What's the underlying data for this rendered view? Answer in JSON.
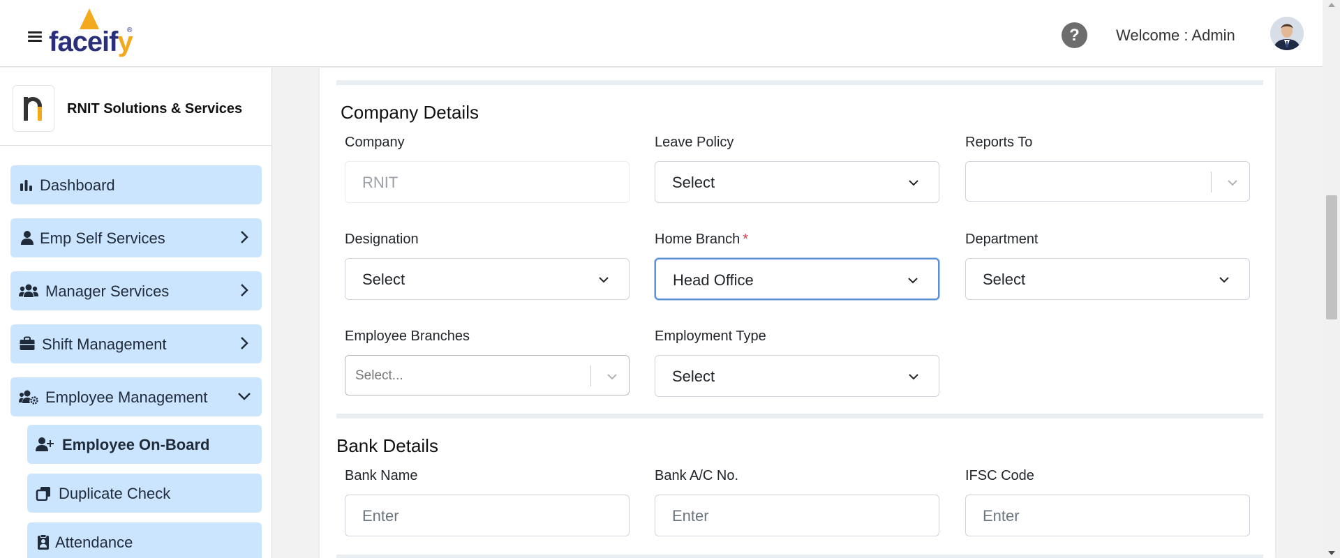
{
  "header": {
    "logo_text": "faceif",
    "logo_text_y": "y",
    "logo_reg": "®",
    "help_symbol": "?",
    "welcome": "Welcome : Admin"
  },
  "sidebar": {
    "org_name": "RNIT Solutions & Services",
    "items": [
      {
        "label": "Dashboard",
        "icon": "bar-chart-icon",
        "chevron": "none"
      },
      {
        "label": "Emp Self Services",
        "icon": "person-icon",
        "chevron": "right"
      },
      {
        "label": "Manager Services",
        "icon": "users-icon",
        "chevron": "right"
      },
      {
        "label": "Shift Management",
        "icon": "briefcase-icon",
        "chevron": "right"
      },
      {
        "label": "Employee Management",
        "icon": "users-gear-icon",
        "chevron": "down"
      },
      {
        "label": "Employee On-Board",
        "icon": "user-plus-icon",
        "active": true
      },
      {
        "label": "Duplicate Check",
        "icon": "copy-icon"
      },
      {
        "label": "Attendance",
        "icon": "clipboard-user-icon"
      }
    ]
  },
  "company_details": {
    "title": "Company Details",
    "company": {
      "label": "Company",
      "value": "RNIT"
    },
    "leave_policy": {
      "label": "Leave Policy",
      "value": "Select"
    },
    "reports_to": {
      "label": "Reports To",
      "value": ""
    },
    "designation": {
      "label": "Designation",
      "value": "Select"
    },
    "home_branch": {
      "label": "Home Branch",
      "required_mark": "*",
      "value": "Head Office"
    },
    "department": {
      "label": "Department",
      "value": "Select"
    },
    "employee_branches": {
      "label": "Employee Branches",
      "placeholder": "Select..."
    },
    "employment_type": {
      "label": "Employment Type",
      "value": "Select"
    }
  },
  "bank_details": {
    "title": "Bank Details",
    "bank_name": {
      "label": "Bank Name",
      "placeholder": "Enter"
    },
    "account_no": {
      "label": "Bank A/C No.",
      "placeholder": "Enter"
    },
    "ifsc": {
      "label": "IFSC Code",
      "placeholder": "Enter"
    }
  },
  "colors": {
    "nav_bg": "#cce5ff",
    "brand_navy": "#2a2f7a",
    "brand_orange": "#f2a91c",
    "required": "#dc3545",
    "focus_border": "#5a8fd8"
  }
}
